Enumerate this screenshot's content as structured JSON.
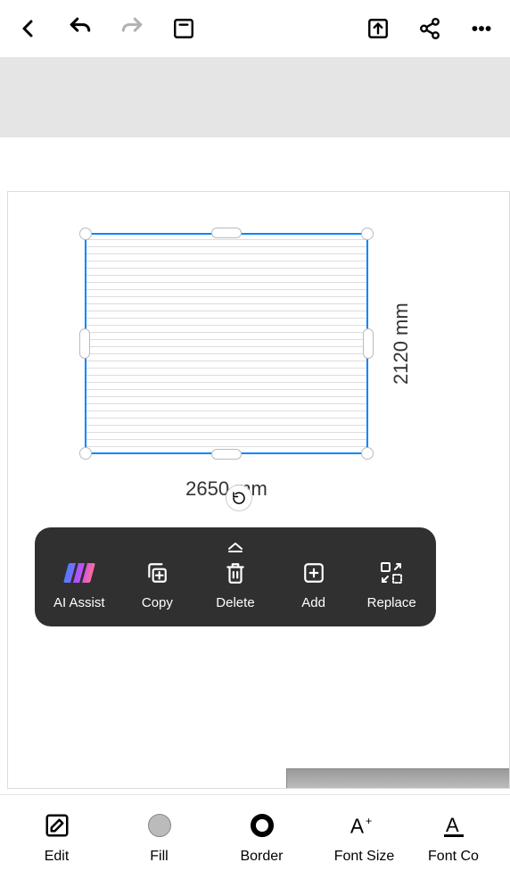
{
  "toolbar_top": {
    "back": "back",
    "undo": "undo",
    "redo": "redo",
    "save": "save",
    "export": "export",
    "share": "share",
    "more": "more"
  },
  "selection": {
    "width_label": "2650 mm",
    "height_label": "2120 mm",
    "border_color": "#0a84ff"
  },
  "context_menu": {
    "items": [
      {
        "label": "AI Assist",
        "icon": "ai-assist-icon"
      },
      {
        "label": "Copy",
        "icon": "copy-icon"
      },
      {
        "label": "Delete",
        "icon": "delete-icon"
      },
      {
        "label": "Add",
        "icon": "add-icon"
      },
      {
        "label": "Replace",
        "icon": "replace-icon"
      }
    ]
  },
  "bottom_bar": {
    "items": [
      {
        "label": "Edit",
        "icon": "edit-icon"
      },
      {
        "label": "Fill",
        "icon": "fill-icon"
      },
      {
        "label": "Border",
        "icon": "border-icon"
      },
      {
        "label": "Font Size",
        "icon": "font-size-icon"
      },
      {
        "label": "Font Co",
        "icon": "font-color-icon"
      }
    ]
  }
}
